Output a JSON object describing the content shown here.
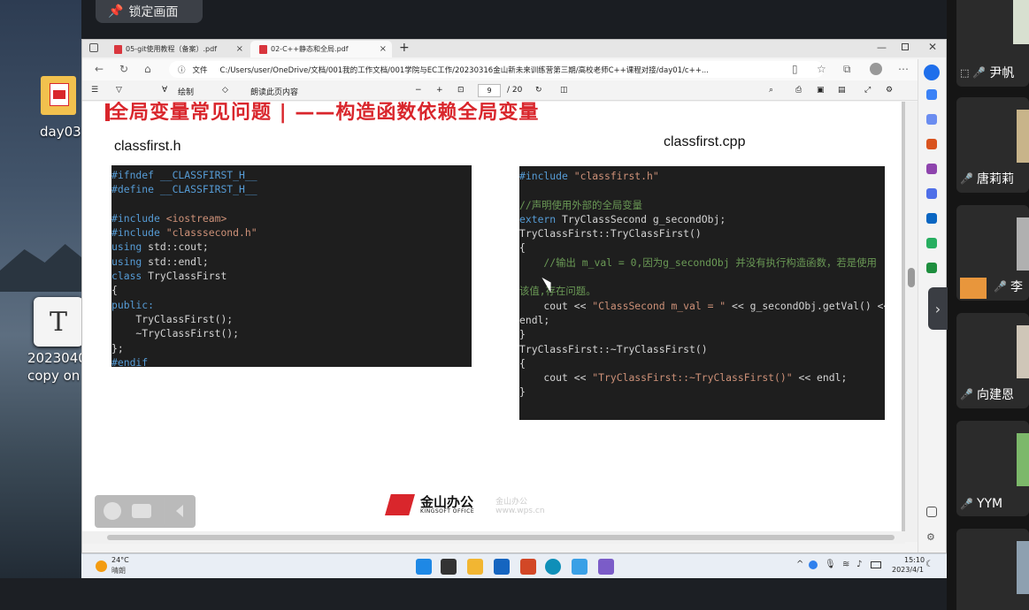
{
  "lock_button": "锁定画面",
  "desktop": {
    "icons": [
      {
        "label": "day03"
      },
      {
        "label": "2023040",
        "label2": "copy on",
        "glyph": "T"
      }
    ]
  },
  "browser": {
    "tabs": [
      {
        "label": "05-git使用教程（备案）.pdf",
        "close": "×"
      },
      {
        "label": "02-C++静态和全局.pdf",
        "close": "×"
      }
    ],
    "new_tab": "+",
    "address": {
      "label": "文件",
      "url": "C:/Users/user/OneDrive/文档/001我的工作文档/001学院与EC工作/20230316金山新未来训练营第三期/高校老师C++课程对接/day01/c++..."
    },
    "pdf_toolbar": {
      "draw": "绘制",
      "read_aloud": "朗读此页内容",
      "minus": "−",
      "plus": "+",
      "page": "9",
      "total": "/ 20"
    }
  },
  "slide": {
    "title": "全局变量常见问题 | ——构造函数依赖全局变量",
    "left_file": "classfirst.h",
    "right_file": "classfirst.cpp",
    "left_code": [
      [
        [
          "kw",
          "#ifndef __CLASSFIRST_H__"
        ]
      ],
      [
        [
          "kw",
          "#define __CLASSFIRST_H__"
        ]
      ],
      [
        [
          "",
          ""
        ]
      ],
      [
        [
          "kw",
          "#include "
        ],
        [
          "str",
          "<iostream>"
        ]
      ],
      [
        [
          "kw",
          "#include "
        ],
        [
          "str",
          "\"classsecond.h\""
        ]
      ],
      [
        [
          "kw",
          "using"
        ],
        [
          "",
          " std::cout;"
        ]
      ],
      [
        [
          "kw",
          "using"
        ],
        [
          "",
          " std::endl;"
        ]
      ],
      [
        [
          "kw",
          "class"
        ],
        [
          "",
          " TryClassFirst"
        ]
      ],
      [
        [
          "",
          "{"
        ]
      ],
      [
        [
          "kw",
          "public:"
        ]
      ],
      [
        [
          "",
          "    TryClassFirst();"
        ]
      ],
      [
        [
          "",
          "    ~TryClassFirst();"
        ]
      ],
      [
        [
          "",
          "};"
        ]
      ],
      [
        [
          "kw",
          "#endif"
        ]
      ]
    ],
    "right_code": [
      [
        [
          "kw",
          "#include "
        ],
        [
          "str",
          "\"classfirst.h\""
        ]
      ],
      [
        [
          "",
          ""
        ]
      ],
      [
        [
          "cm",
          "//声明使用外部的全局变量"
        ]
      ],
      [
        [
          "kw",
          "extern"
        ],
        [
          "",
          " TryClassSecond g_secondObj;"
        ]
      ],
      [
        [
          "",
          "TryClassFirst::TryClassFirst()"
        ]
      ],
      [
        [
          "",
          "{"
        ]
      ],
      [
        [
          "cm",
          "    //输出 m_val = 0,因为g_secondObj 并没有执行构造函数，若是使用"
        ]
      ],
      [
        [
          "",
          ""
        ]
      ],
      [
        [
          "cm",
          "该值,存在问题。"
        ]
      ],
      [
        [
          "",
          "    cout << "
        ],
        [
          "str",
          "\"ClassSecond m_val = \""
        ],
        [
          "",
          " << g_secondObj.getVal() <<"
        ]
      ],
      [
        [
          "",
          "endl;"
        ]
      ],
      [
        [
          "",
          "}"
        ]
      ],
      [
        [
          "",
          "TryClassFirst::~TryClassFirst()"
        ]
      ],
      [
        [
          "",
          "{"
        ]
      ],
      [
        [
          "",
          "    cout << "
        ],
        [
          "str",
          "\"TryClassFirst::~TryClassFirst()\""
        ],
        [
          "",
          " << endl;"
        ]
      ],
      [
        [
          "",
          "}"
        ]
      ]
    ],
    "logo_text": "金山办公",
    "logo_sub": "KINGSOFT OFFICE",
    "logo_side": "金山办公",
    "logo_url": "www.wps.cn"
  },
  "taskbar": {
    "weather_temp": "24°C",
    "weather_text": "晴朗",
    "time": "15:10",
    "date": "2023/4/1"
  },
  "participants": [
    {
      "name": "尹帆",
      "mic": "muted"
    },
    {
      "name": "唐莉莉",
      "mic": "muted"
    },
    {
      "name": "李",
      "mic": "muted"
    },
    {
      "name": "向建恩",
      "mic": "muted"
    },
    {
      "name": "YYM",
      "mic": "muted"
    }
  ],
  "colors": {
    "accent": "#d9262c",
    "code_bg": "#1e1e1e",
    "keyword": "#569cd6",
    "string": "#ce9178",
    "comment": "#6a9955"
  }
}
